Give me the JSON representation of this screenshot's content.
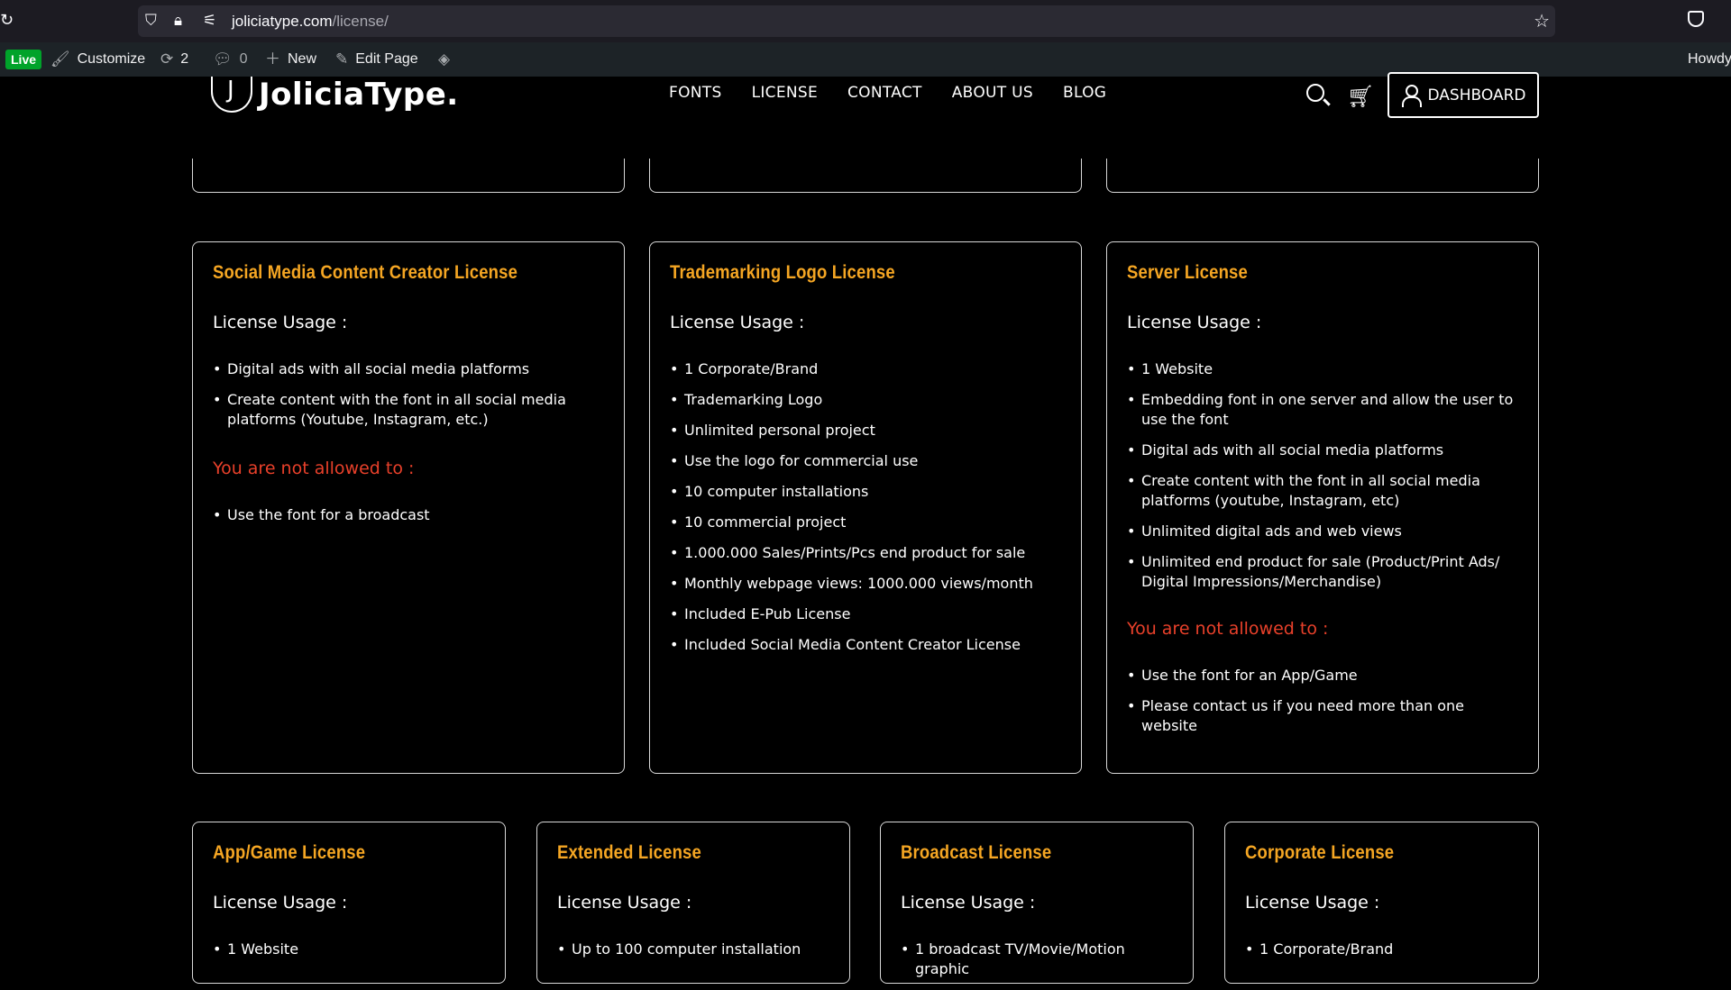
{
  "browser": {
    "url_domain": "joliciatype.com",
    "url_path": "/license/"
  },
  "admin_bar": {
    "live": "Live",
    "customize": "Customize",
    "updates_count": "2",
    "comments_count": "0",
    "new": "New",
    "edit_page": "Edit Page",
    "howdy": "Howdy"
  },
  "header": {
    "logo_mark": "J",
    "logo_text": "JoliciaType.",
    "nav": [
      "FONTS",
      "LICENSE",
      "CONTACT",
      "ABOUT US",
      "BLOG"
    ],
    "dashboard": "DASHBOARD"
  },
  "cards_row2": [
    {
      "title": "Social Media Content Creator License",
      "usage_label": "License Usage :",
      "usage": [
        "Digital ads with all social media platforms",
        "Create content with the font in all social media platforms (Youtube, Instagram, etc.)"
      ],
      "not_allowed_label": "You are not allowed to :",
      "not_allowed": [
        "Use the font for a broadcast"
      ]
    },
    {
      "title": "Trademarking Logo License",
      "usage_label": "License Usage :",
      "usage": [
        "1 Corporate/Brand",
        "Trademarking Logo",
        "Unlimited personal project",
        "Use the logo for commercial use",
        "10 computer installations",
        "10 commercial project",
        "1.000.000 Sales/Prints/Pcs end product for sale",
        "Monthly webpage views: 1000.000 views/month",
        "Included E-Pub License",
        "Included Social Media Content Creator License"
      ]
    },
    {
      "title": "Server License",
      "usage_label": "License Usage :",
      "usage": [
        "1 Website",
        "Embedding font in one server and allow the user to use the font",
        "Digital ads with all social media platforms",
        "Create content with the font in all social media platforms (youtube, Instagram, etc)",
        "Unlimited digital ads and web views",
        "Unlimited end product for sale (Product/Print Ads/ Digital Impressions/Merchandise)"
      ],
      "not_allowed_label": "You are not allowed to :",
      "not_allowed": [
        "Use the font for an App/Game",
        "Please contact us if you need more than one website"
      ]
    }
  ],
  "cards_row3": [
    {
      "title": "App/Game License",
      "usage_label": "License Usage :",
      "usage": [
        "1 Website"
      ]
    },
    {
      "title": "Extended License",
      "usage_label": "License Usage :",
      "usage": [
        "Up to 100 computer installation"
      ]
    },
    {
      "title": "Broadcast License",
      "usage_label": "License Usage :",
      "usage": [
        "1 broadcast TV/Movie/Motion graphic"
      ]
    },
    {
      "title": "Corporate License",
      "usage_label": "License Usage :",
      "usage": [
        "1 Corporate/Brand"
      ]
    }
  ]
}
